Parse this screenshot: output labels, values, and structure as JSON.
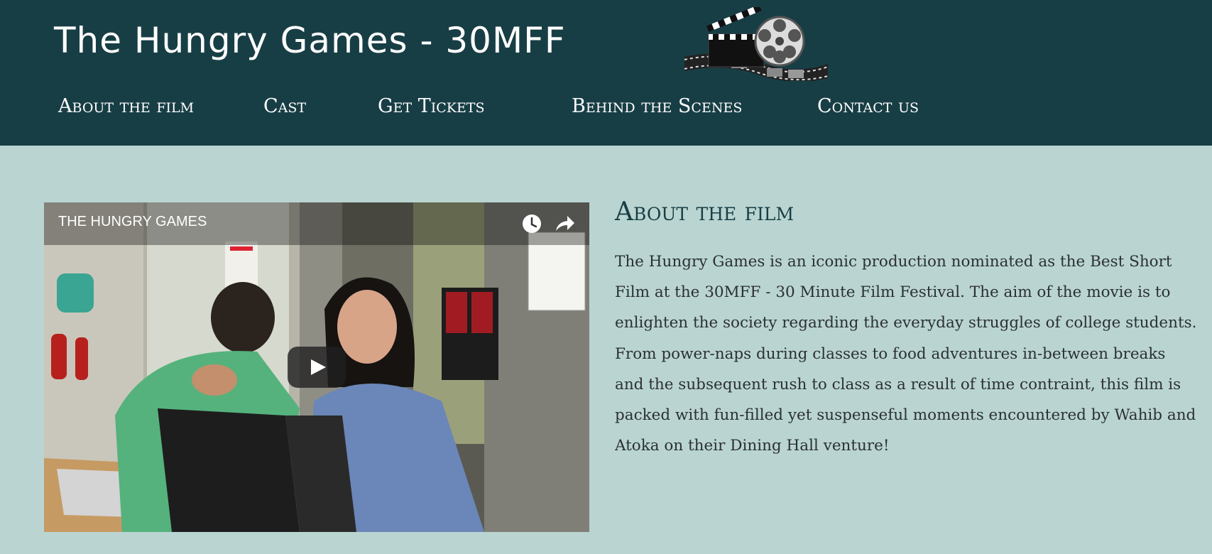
{
  "header": {
    "site_title": "The Hungry Games - 30MFF"
  },
  "nav": {
    "items": [
      {
        "label": "About the film"
      },
      {
        "label": "Cast"
      },
      {
        "label": "Get Tickets"
      },
      {
        "label": "Behind the Scenes"
      },
      {
        "label": "Contact us"
      }
    ]
  },
  "video": {
    "title": "THE HUNGRY GAMES",
    "icons": [
      "clock-icon",
      "share-icon",
      "play-icon"
    ]
  },
  "about": {
    "heading": "About the film",
    "body": "The Hungry Games is an iconic production nominated as the Best Short Film at the 30MFF - 30 Minute Film Festival. The aim of the movie is to enlighten the society regarding the everyday struggles of college students. From power-naps during classes to food adventures in-between breaks and the subsequent rush to class as a result of time contraint, this film is packed with fun-filled yet suspenseful moments encountered by Wahib and Atoka on their Dining Hall venture!"
  },
  "colors": {
    "header_bg": "#183e45",
    "page_bg": "#bad5d1",
    "heading_text": "#183e45",
    "body_text": "#2b3035"
  }
}
